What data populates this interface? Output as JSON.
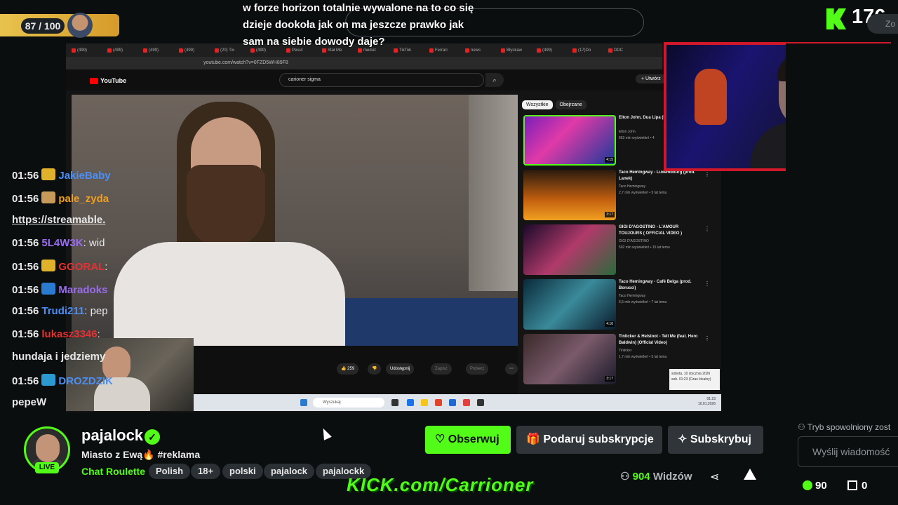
{
  "progress": {
    "text": "87 / 100",
    "value": 0.87
  },
  "overlay": {
    "lines": [
      "w forze horizon totalnie wywalone na to co się",
      "dzieje dookoła jak on ma jeszcze prawko jak",
      "sam na siebie dowody daje?"
    ]
  },
  "kick_counter": "176",
  "zoom_label": "Zo",
  "browser": {
    "tabs": [
      "(499)",
      "(499)",
      "(499)",
      "(499)",
      "(20) Tw",
      "(499)",
      "Pesut",
      "Stał Me",
      "meduz",
      "TikTok",
      "Ferrari",
      "news",
      "Błyskaw",
      "(499)",
      "(17)Do",
      "DDC"
    ],
    "url": "youtube.com/watch?v=0FZD5WH89F8"
  },
  "youtube": {
    "logo": "YouTube",
    "search_value": "carioner sigma",
    "create_label": "+ Utwórz",
    "chips": [
      "Wszystkie",
      "Obejrzane"
    ],
    "actions": {
      "likes": "259",
      "share": "Udostępnij",
      "save": "Zapisz",
      "download": "Pobierz"
    },
    "recs": [
      {
        "title": "Elton John, Dua Lipa (PNAU Remix) (Offic",
        "channel": "Elton John",
        "meta": "663 mln wyświetleń • 4",
        "duration": "4:15"
      },
      {
        "title": "Taco Hemingway - Luxembourg (prod. Lanek)",
        "channel": "Taco Hemingway",
        "meta": "2,7 mln wyświetleń • 5 lat temu",
        "duration": "3:17"
      },
      {
        "title": "GIGI D'AGOSTINO - L'AMOUR TOUJOURS ( OFFICIAL VIDEO )",
        "channel": "GIGI D'AGOSTINO",
        "meta": "592 mln wyświetleń • 15 lat temu",
        "duration": ""
      },
      {
        "title": "Taco Hemingway - Café Belga (prod. Borucci)",
        "channel": "Taco Hemingway",
        "meta": "6,5 mln wyświetleń • 7 lat temu",
        "duration": "4:10"
      },
      {
        "title": "Tinlicker & Helsloot - Tell Me (feat. Hero Baldwin) (Official Video)",
        "channel": "Tinlicker",
        "meta": "1,7 mln wyświetleń • 5 lat temu",
        "duration": "3:17"
      }
    ],
    "notif": {
      "line1": "sobota, 10 stycznia 2026",
      "line2": "sob. 01:23 (Czas lokalny)"
    },
    "taskbar_search": "Wyszukaj",
    "taskbar_time": "01:23",
    "taskbar_date": "10.01.2026"
  },
  "chat": {
    "messages": [
      {
        "time": "01:56",
        "user": "JakieBaby",
        "color": "#4a8ff7",
        "text": "",
        "badge": "#e0b22c"
      },
      {
        "time": "01:56",
        "user": "pale_zyda",
        "color": "#f0a020",
        "text": "",
        "badge": "#c89a5a"
      },
      {
        "time": "",
        "user": "",
        "color": "#e8e8e8",
        "text": "https://streamable.",
        "badge": ""
      },
      {
        "time": "01:56",
        "user": "5L4W3K",
        "color": "#9a6cf0",
        "text": ": wid",
        "badge": ""
      },
      {
        "time": "01:56",
        "user": "GGORAL",
        "color": "#e83030",
        "text": ":",
        "badge": "#e0b22c"
      },
      {
        "time": "01:56",
        "user": "Maradoks",
        "color": "#9a6cf0",
        "text": "",
        "badge": "#2a7ad0"
      },
      {
        "time": "01:56",
        "user": "Trudi211",
        "color": "#4a8ff7",
        "text": ": pep",
        "badge": ""
      },
      {
        "time": "01:56",
        "user": "lukasz3346",
        "color": "#e83030",
        "text": ":",
        "badge": ""
      },
      {
        "time": "",
        "user": "",
        "color": "#e8e8e8",
        "text": "hundaja i jedziemy",
        "badge": ""
      },
      {
        "time": "01:56",
        "user": "DROZDZIK",
        "color": "#4a8ff7",
        "text": "",
        "badge": "#2a9ad0"
      },
      {
        "time": "",
        "user": "",
        "color": "#e8e8e8",
        "text": "pepeW",
        "badge": ""
      }
    ],
    "slow_mode": "Tryb spowolniony zost",
    "input_placeholder": "Wyślij wiadomość",
    "points": "90",
    "gifts": "0"
  },
  "channel": {
    "name": "pajalock",
    "live": "LIVE",
    "title": "Miasto z Ewą🔥 #reklama",
    "category": "Chat Roulette",
    "tags": [
      "Polish",
      "18+",
      "polski",
      "pajalock",
      "pajalockk"
    ],
    "follow": "Obserwuj",
    "gift_sub": "Podaruj subskrypcje",
    "subscribe": "Subskrybuj",
    "viewers_count": "904",
    "viewers_label": "Widzów"
  },
  "watermark": "KICK.com/Carrioner",
  "colors": {
    "kick_green": "#53fc18",
    "facecam_border": "#d1182a"
  }
}
